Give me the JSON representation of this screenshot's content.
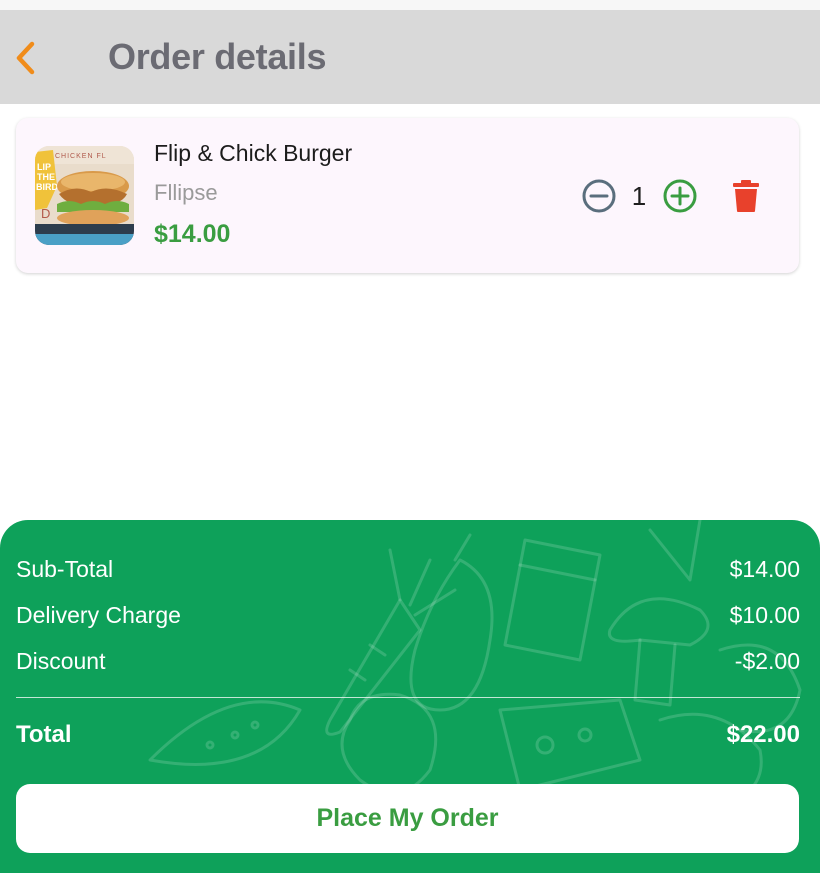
{
  "header": {
    "title": "Order details",
    "back_icon": "chevron-left-icon",
    "accent_color": "#f08c1a"
  },
  "cart": {
    "items": [
      {
        "name": "Flip & Chick Burger",
        "shop": "Fllipse",
        "price": "$14.00",
        "quantity": "1",
        "image_icon": "burger-photo",
        "image_text": "FLIP THE BIRD"
      }
    ]
  },
  "summary": {
    "subtotal_label": "Sub-Total",
    "subtotal_value": "$14.00",
    "delivery_label": "Delivery Charge",
    "delivery_value": "$10.00",
    "discount_label": "Discount",
    "discount_value": "-$2.00",
    "total_label": "Total",
    "total_value": "$22.00",
    "background_color": "#0ea15a"
  },
  "actions": {
    "place_order_label": "Place My Order"
  },
  "colors": {
    "price_green": "#3a9d41",
    "delete_red": "#e8412c",
    "minus_gray": "#5a6e7d",
    "plus_green": "#3a9d41"
  }
}
